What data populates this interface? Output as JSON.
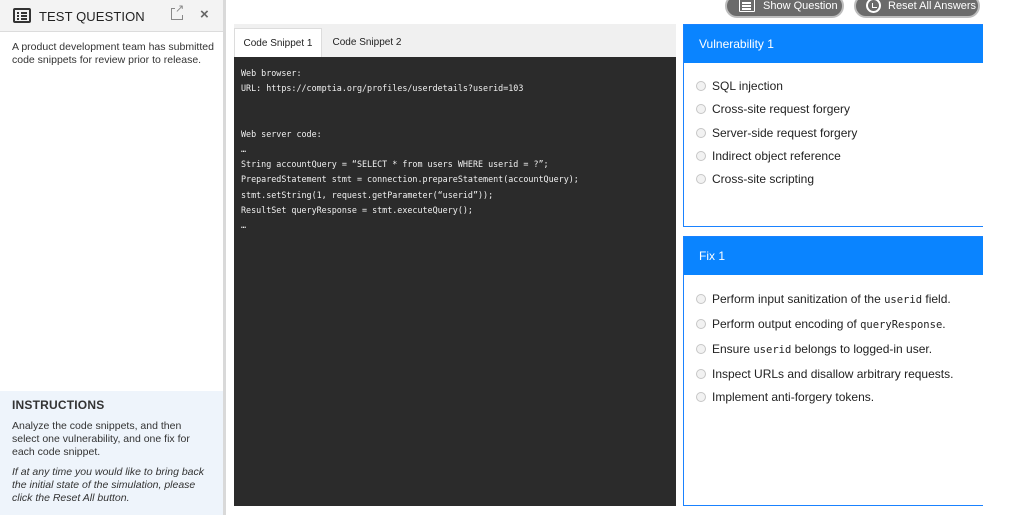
{
  "sidebar": {
    "title": "TEST QUESTION",
    "question": "A product development team has submitted code snippets for review prior to release.",
    "instructions": {
      "title": "INSTRUCTIONS",
      "text": "Analyze the code snippets, and then select one vulnerability, and one fix for each code snippet.",
      "italic": "If at any time you would like to bring back the initial state of the simulation, please click the Reset All button."
    }
  },
  "toolbar": {
    "show_question": "Show Question",
    "reset_all": "Reset All Answers"
  },
  "code": {
    "tabs": [
      "Code Snippet 1",
      "Code Snippet 2"
    ],
    "lines": [
      "Web browser:",
      "URL: https://comptia.org/profiles/userdetails?userid=103",
      "",
      "",
      "Web server code:",
      "…",
      "String accountQuery = “SELECT * from users WHERE userid = ?”;",
      "PreparedStatement stmt = connection.prepareStatement(accountQuery);",
      "stmt.setString(1, request.getParameter(“userid”));",
      "ResultSet queryResponse = stmt.executeQuery();",
      "…"
    ]
  },
  "vulnerability": {
    "title": "Vulnerability 1",
    "options": [
      "SQL injection",
      "Cross-site request forgery",
      "Server-side request forgery",
      "Indirect object reference",
      "Cross-site scripting"
    ]
  },
  "fix": {
    "title": "Fix 1",
    "options": [
      {
        "pre": "Perform input sanitization of the ",
        "code": "userid",
        "post": " field."
      },
      {
        "pre": "Perform output encoding of ",
        "code": "queryResponse",
        "post": "."
      },
      {
        "pre": "Ensure ",
        "code": "userid",
        "post": " belongs to logged-in user."
      },
      {
        "pre": "Inspect URLs and disallow arbitrary requests.",
        "code": "",
        "post": ""
      },
      {
        "pre": "Implement anti-forgery tokens.",
        "code": "",
        "post": ""
      }
    ]
  }
}
